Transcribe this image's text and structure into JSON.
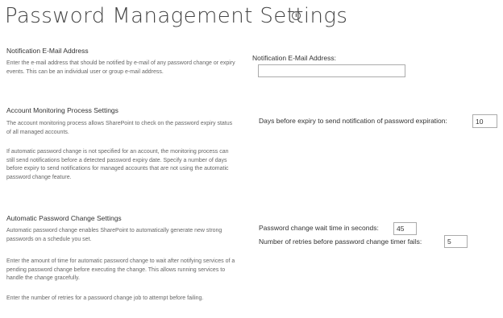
{
  "page": {
    "title": "Password Management Settings",
    "info_icon": "info-circle-icon",
    "info_glyph": "i"
  },
  "notification_email": {
    "heading": "Notification E-Mail Address",
    "description": "Enter the e-mail address that should be notified by e-mail of any password change or expiry events. This can be an individual user or group e-mail address.",
    "field_label": "Notification E-Mail Address:",
    "field_value": ""
  },
  "account_monitoring": {
    "heading": "Account Monitoring Process Settings",
    "description_1": "The account monitoring process allows SharePoint to check on the password expiry status of all managed accounts.",
    "description_2": "If automatic password change is not specified for an account, the monitoring process can still send notifications before a detected password expiry date. Specify a number of days before expiry to send notifications for managed accounts that are not using the automatic password change feature.",
    "field_label": "Days before expiry to send notification of password expiration:",
    "field_value": "10"
  },
  "automatic_change": {
    "heading": "Automatic Password Change Settings",
    "description_1": "Automatic password change enables SharePoint to automatically generate new strong passwords on a schedule you set.",
    "description_2": "Enter the amount of time for automatic password change to wait after notifying services of a pending password change before executing the change. This allows running services to handle the change gracefully.",
    "description_3": "Enter the number of retries for a password change job to attempt before failing.",
    "wait_label": "Password change wait time in seconds:",
    "wait_value": "45",
    "retries_label": "Number of retries before password change timer fails:",
    "retries_value": "5"
  }
}
